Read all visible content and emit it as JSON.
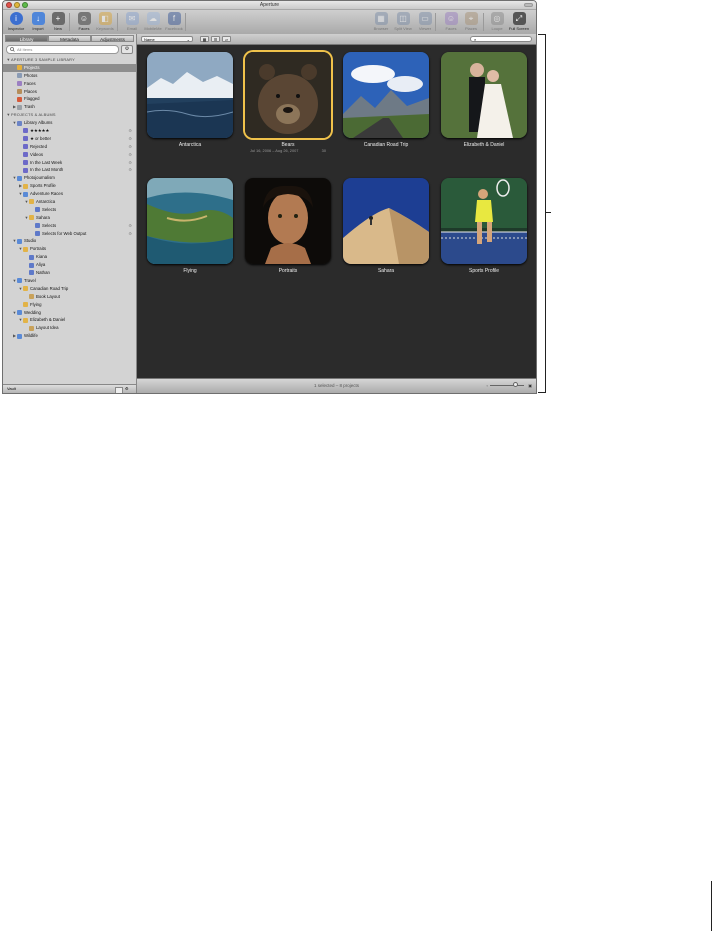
{
  "window": {
    "title": "Aperture"
  },
  "toolbar": {
    "buttons": [
      {
        "label": "Inspector",
        "icon": "info-icon",
        "color": "#3c6fd0"
      },
      {
        "label": "Import",
        "icon": "import-arrow-icon",
        "color": "#4f86d9"
      },
      {
        "label": "New",
        "icon": "new-project-icon",
        "color": "#6b6b6b"
      },
      {
        "label": "Faces",
        "icon": "faces-icon",
        "color": "#777777"
      },
      {
        "label": "Keywords",
        "icon": "keywords-icon",
        "color": "#d9a63c"
      },
      {
        "label": "Email",
        "icon": "email-icon",
        "color": "#8aa4cf"
      },
      {
        "label": "MobileMe",
        "icon": "mobileme-cloud-icon",
        "color": "#9eb6d8"
      },
      {
        "label": "Facebook",
        "icon": "facebook-icon",
        "color": "#3b5998"
      },
      {
        "label": "Browser",
        "icon": "browser-icon",
        "color": "#7d8ea8"
      },
      {
        "label": "Split View",
        "icon": "split-view-icon",
        "color": "#7d8ea8"
      },
      {
        "label": "Viewer",
        "icon": "viewer-icon",
        "color": "#7d8ea8"
      },
      {
        "label": "Faces",
        "icon": "faces-view-icon",
        "color": "#9a7fbf"
      },
      {
        "label": "Places",
        "icon": "places-view-icon",
        "color": "#a79277"
      },
      {
        "label": "Loupe",
        "icon": "loupe-icon",
        "color": "#8a8a8a"
      },
      {
        "label": "Full Screen",
        "icon": "full-screen-icon",
        "color": "#555555"
      }
    ]
  },
  "sidebar": {
    "tabs": [
      "Library",
      "Metadata",
      "Adjustments"
    ],
    "search_placeholder": "All Items",
    "rows": [
      {
        "label": "APERTURE 3 SAMPLE LIBRARY",
        "depth": 0,
        "tri": "▼",
        "kind": "header"
      },
      {
        "label": "Projects",
        "depth": 1,
        "tri": "",
        "kind": "projects",
        "selected": true
      },
      {
        "label": "Photos",
        "depth": 1,
        "tri": "",
        "kind": "photos"
      },
      {
        "label": "Faces",
        "depth": 1,
        "tri": "",
        "kind": "faces"
      },
      {
        "label": "Places",
        "depth": 1,
        "tri": "",
        "kind": "places"
      },
      {
        "label": "Flagged",
        "depth": 1,
        "tri": "",
        "kind": "flag"
      },
      {
        "label": "Trash",
        "depth": 1,
        "tri": "▶",
        "kind": "trash"
      },
      {
        "label": "PROJECTS & ALBUMS",
        "depth": 0,
        "tri": "▼",
        "kind": "header"
      },
      {
        "label": "Library Albums",
        "depth": 1,
        "tri": "▼",
        "kind": "albumfolder"
      },
      {
        "label": "★★★★★",
        "depth": 2,
        "tri": "",
        "kind": "smart",
        "smart": true
      },
      {
        "label": "★ or better",
        "depth": 2,
        "tri": "",
        "kind": "smart",
        "smart": true
      },
      {
        "label": "Rejected",
        "depth": 2,
        "tri": "",
        "kind": "smart",
        "smart": true
      },
      {
        "label": "Videos",
        "depth": 2,
        "tri": "",
        "kind": "smart",
        "smart": true
      },
      {
        "label": "In the Last Week",
        "depth": 2,
        "tri": "",
        "kind": "smart",
        "smart": true
      },
      {
        "label": "In the Last Month",
        "depth": 2,
        "tri": "",
        "kind": "smart",
        "smart": true
      },
      {
        "label": "Photojournalism",
        "depth": 1,
        "tri": "▼",
        "kind": "folder"
      },
      {
        "label": "Sports Profile",
        "depth": 2,
        "tri": "▶",
        "kind": "project"
      },
      {
        "label": "Adventure Races",
        "depth": 2,
        "tri": "▼",
        "kind": "folder"
      },
      {
        "label": "Antarctica",
        "depth": 3,
        "tri": "▼",
        "kind": "project"
      },
      {
        "label": "Selects",
        "depth": 4,
        "tri": "",
        "kind": "album"
      },
      {
        "label": "Sahara",
        "depth": 3,
        "tri": "▼",
        "kind": "project"
      },
      {
        "label": "Selects",
        "depth": 4,
        "tri": "",
        "kind": "album",
        "smart": true
      },
      {
        "label": "Selects for Web Output",
        "depth": 4,
        "tri": "",
        "kind": "album",
        "smart": true
      },
      {
        "label": "Studio",
        "depth": 1,
        "tri": "▼",
        "kind": "folder"
      },
      {
        "label": "Portraits",
        "depth": 2,
        "tri": "▼",
        "kind": "project"
      },
      {
        "label": "Kiana",
        "depth": 3,
        "tri": "",
        "kind": "album"
      },
      {
        "label": "Aliya",
        "depth": 3,
        "tri": "",
        "kind": "album"
      },
      {
        "label": "Nathan",
        "depth": 3,
        "tri": "",
        "kind": "album"
      },
      {
        "label": "Travel",
        "depth": 1,
        "tri": "▼",
        "kind": "folder"
      },
      {
        "label": "Canadian Road Trip",
        "depth": 2,
        "tri": "▼",
        "kind": "project"
      },
      {
        "label": "Book Layout",
        "depth": 3,
        "tri": "",
        "kind": "book"
      },
      {
        "label": "Flying",
        "depth": 2,
        "tri": "",
        "kind": "project"
      },
      {
        "label": "Wedding",
        "depth": 1,
        "tri": "▼",
        "kind": "folder"
      },
      {
        "label": "Elizabeth & Daniel",
        "depth": 2,
        "tri": "▼",
        "kind": "project"
      },
      {
        "label": "Layout Idea",
        "depth": 3,
        "tri": "",
        "kind": "book"
      },
      {
        "label": "Wildlife",
        "depth": 1,
        "tri": "▶",
        "kind": "folder"
      }
    ],
    "footer_label": "Vault"
  },
  "browser": {
    "sort_label": "Name",
    "filter_placeholder": "",
    "status": "1 selected – 8 projects",
    "projects": [
      {
        "name": "Antarctica",
        "scene": "antarctica"
      },
      {
        "name": "Bears",
        "scene": "bears",
        "selected": true,
        "dates": "Jul 16, 2006 – Aug 26, 2007",
        "count": "30"
      },
      {
        "name": "Canadian Road Trip",
        "scene": "canada"
      },
      {
        "name": "Elizabeth & Daniel",
        "scene": "wedding"
      },
      {
        "name": "Flying",
        "scene": "flying"
      },
      {
        "name": "Portraits",
        "scene": "portrait"
      },
      {
        "name": "Sahara",
        "scene": "sahara"
      },
      {
        "name": "Sports Profile",
        "scene": "tennis"
      }
    ]
  },
  "colors": {
    "selection": "#f0c24b",
    "browser_bg": "#2b2b2b",
    "sidebar_bg": "#d3d3d3"
  }
}
